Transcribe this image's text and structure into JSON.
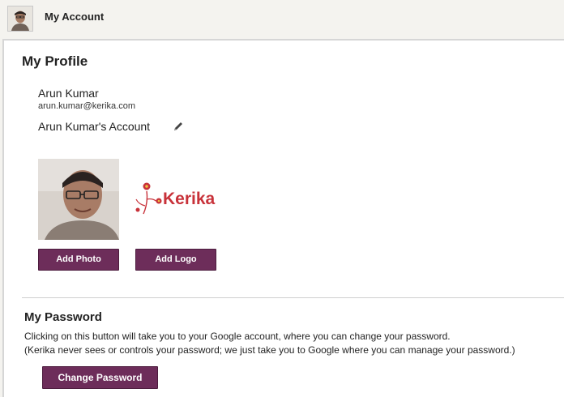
{
  "header": {
    "title": "My Account"
  },
  "profile": {
    "heading": "My Profile",
    "name": "Arun Kumar",
    "email": "arun.kumar@kerika.com",
    "account_name": "Arun Kumar's Account",
    "add_photo_label": "Add Photo",
    "add_logo_label": "Add Logo",
    "logo_text": "Kerika"
  },
  "password": {
    "heading": "My Password",
    "description_line1": "Clicking on this button will take you to your Google account, where you can change your password.",
    "description_line2": "(Kerika never sees or controls your password; we just take you to Google where you can manage your password.)",
    "change_label": "Change Password"
  },
  "colors": {
    "button": "#6d2d5a",
    "logo_red": "#c8323a"
  }
}
